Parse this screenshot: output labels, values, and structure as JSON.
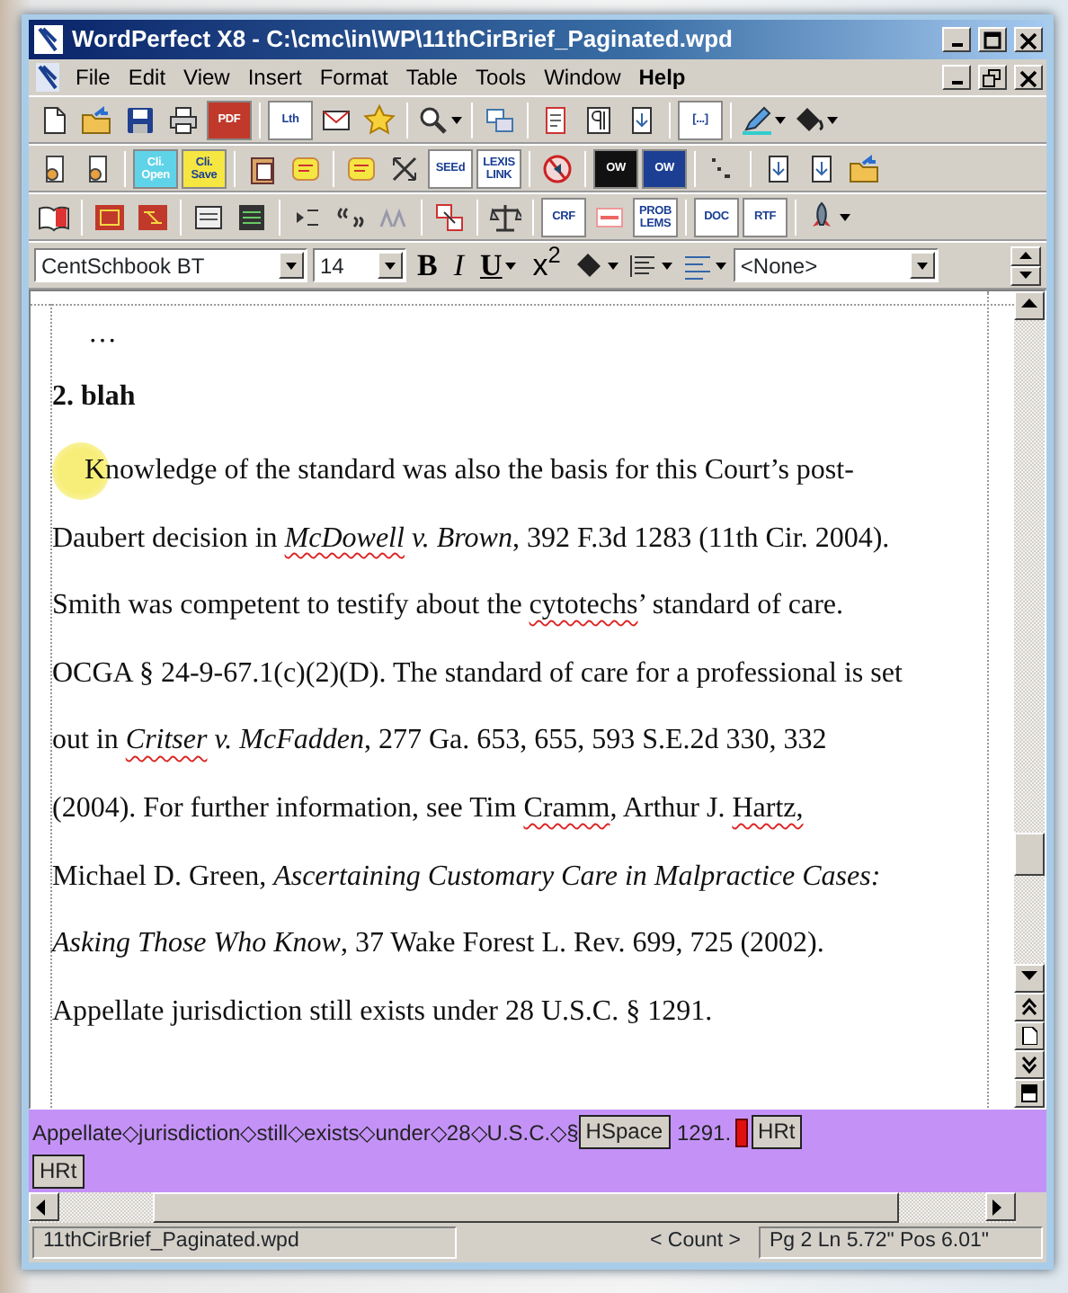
{
  "window": {
    "title": "WordPerfect X8 - C:\\cmc\\in\\WP\\11thCirBrief_Paginated.wpd"
  },
  "menu": [
    {
      "label": "File",
      "emphasized": false
    },
    {
      "label": "Edit",
      "emphasized": false
    },
    {
      "label": "View",
      "emphasized": false
    },
    {
      "label": "Insert",
      "emphasized": false
    },
    {
      "label": "Format",
      "emphasized": false
    },
    {
      "label": "Table",
      "emphasized": false
    },
    {
      "label": "Tools",
      "emphasized": false
    },
    {
      "label": "Window",
      "emphasized": false
    },
    {
      "label": "Help",
      "emphasized": true
    }
  ],
  "toolbars": [
    [
      {
        "kind": "icon"
      },
      {
        "kind": "icon"
      },
      {
        "kind": "icon"
      },
      {
        "kind": "icon"
      },
      {
        "kind": "label",
        "text": "PDF",
        "color": "#c0392b"
      },
      {
        "kind": "separator"
      },
      {
        "kind": "label",
        "text": "Lth",
        "color": "#ffffff"
      },
      {
        "kind": "icon"
      },
      {
        "kind": "icon"
      },
      {
        "kind": "separator"
      },
      {
        "kind": "icon",
        "dropdown": true
      },
      {
        "kind": "separator"
      },
      {
        "kind": "icon"
      },
      {
        "kind": "separator"
      },
      {
        "kind": "icon"
      },
      {
        "kind": "icon"
      },
      {
        "kind": "icon"
      },
      {
        "kind": "separator"
      },
      {
        "kind": "label",
        "text": "[...]",
        "color": "#ffffff"
      },
      {
        "kind": "separator"
      },
      {
        "kind": "icon",
        "dropdown": true
      },
      {
        "kind": "icon",
        "dropdown": true
      }
    ],
    [
      {
        "kind": "icon"
      },
      {
        "kind": "icon"
      },
      {
        "kind": "separator"
      },
      {
        "kind": "label",
        "text": "Cli. Open",
        "color": "#5fd3e8"
      },
      {
        "kind": "label",
        "text": "Cli. Save",
        "color": "#f5e642"
      },
      {
        "kind": "separator"
      },
      {
        "kind": "icon"
      },
      {
        "kind": "icon"
      },
      {
        "kind": "separator"
      },
      {
        "kind": "icon"
      },
      {
        "kind": "icon"
      },
      {
        "kind": "label",
        "text": "SEEd",
        "color": "#ffffff"
      },
      {
        "kind": "label",
        "text": "LEXIS LINK",
        "color": "#ffffff"
      },
      {
        "kind": "separator"
      },
      {
        "kind": "icon"
      },
      {
        "kind": "separator"
      },
      {
        "kind": "label",
        "text": "OW",
        "color": "#111111"
      },
      {
        "kind": "label",
        "text": "OW",
        "color": "#1c3f94"
      },
      {
        "kind": "separator"
      },
      {
        "kind": "icon"
      },
      {
        "kind": "separator"
      },
      {
        "kind": "icon"
      },
      {
        "kind": "icon"
      },
      {
        "kind": "icon"
      }
    ],
    [
      {
        "kind": "icon"
      },
      {
        "kind": "separator"
      },
      {
        "kind": "icon"
      },
      {
        "kind": "icon"
      },
      {
        "kind": "separator"
      },
      {
        "kind": "icon"
      },
      {
        "kind": "icon"
      },
      {
        "kind": "separator"
      },
      {
        "kind": "icon"
      },
      {
        "kind": "icon"
      },
      {
        "kind": "icon"
      },
      {
        "kind": "separator"
      },
      {
        "kind": "icon"
      },
      {
        "kind": "separator"
      },
      {
        "kind": "icon"
      },
      {
        "kind": "separator"
      },
      {
        "kind": "label",
        "text": "CRF",
        "color": "#ffffff"
      },
      {
        "kind": "icon"
      },
      {
        "kind": "label",
        "text": "PROB LEMS",
        "color": "#ffffff"
      },
      {
        "kind": "separator"
      },
      {
        "kind": "label",
        "text": "DOC",
        "color": "#ffffff"
      },
      {
        "kind": "label",
        "text": "RTF",
        "color": "#ffffff"
      },
      {
        "kind": "separator"
      },
      {
        "kind": "icon",
        "dropdown": true
      }
    ]
  ],
  "format_bar": {
    "font": "CentSchbook BT",
    "size": "14",
    "buttons": [
      {
        "label": "B",
        "dropdown": false
      },
      {
        "label": "I",
        "dropdown": false
      },
      {
        "label": "U",
        "dropdown": true
      },
      {
        "label": "x$^{2}$",
        "dropdown": false
      }
    ],
    "style": "<None>"
  },
  "document": {
    "lines": [
      {
        "kind": "ellipsis",
        "segments": [
          {
            "text": "…",
            "italic": false,
            "misspelled": false
          }
        ]
      },
      {
        "kind": "heading",
        "segments": [
          {
            "text": "2. blah",
            "italic": false,
            "misspelled": false
          }
        ]
      },
      {
        "kind": "first",
        "segments": [
          {
            "text": "Knowledge of the standard was also the basis for this Court’s post-",
            "italic": false,
            "misspelled": false
          }
        ]
      },
      {
        "kind": "body",
        "segments": [
          {
            "text": "Daubert decision in ",
            "italic": false,
            "misspelled": false
          },
          {
            "text": "McDowell",
            "italic": true,
            "misspelled": true
          },
          {
            "text": " v. Brown",
            "italic": true,
            "misspelled": false
          },
          {
            "text": ", 392 F.3d 1283 (11th Cir. 2004).",
            "italic": false,
            "misspelled": false
          }
        ]
      },
      {
        "kind": "body",
        "segments": [
          {
            "text": "Smith was competent to testify about the ",
            "italic": false,
            "misspelled": false
          },
          {
            "text": "cytotechs",
            "italic": false,
            "misspelled": true
          },
          {
            "text": "’ standard of care.",
            "italic": false,
            "misspelled": false
          }
        ]
      },
      {
        "kind": "body",
        "segments": [
          {
            "text": "OCGA § 24-9-67.1(c)(2)(D). The standard of care for a professional is set",
            "italic": false,
            "misspelled": false
          }
        ]
      },
      {
        "kind": "body",
        "segments": [
          {
            "text": "out in ",
            "italic": false,
            "misspelled": false
          },
          {
            "text": "Critser",
            "italic": true,
            "misspelled": true
          },
          {
            "text": " v. McFadden",
            "italic": true,
            "misspelled": false
          },
          {
            "text": ", 277 Ga. 653, 655, 593 S.E.2d 330, 332",
            "italic": false,
            "misspelled": false
          }
        ]
      },
      {
        "kind": "body",
        "segments": [
          {
            "text": "(2004). For further information, see Tim ",
            "italic": false,
            "misspelled": false
          },
          {
            "text": "Cramm",
            "italic": false,
            "misspelled": true
          },
          {
            "text": ", Arthur J. ",
            "italic": false,
            "misspelled": false
          },
          {
            "text": "Hartz,",
            "italic": false,
            "misspelled": true
          }
        ]
      },
      {
        "kind": "body",
        "segments": [
          {
            "text": "Michael D. Green, ",
            "italic": false,
            "misspelled": false
          },
          {
            "text": "Ascertaining Customary Care in Malpractice Cases:",
            "italic": true,
            "misspelled": false
          }
        ]
      },
      {
        "kind": "body",
        "segments": [
          {
            "text": "Asking Those Who Know",
            "italic": true,
            "misspelled": false
          },
          {
            "text": ", 37 Wake Forest L. Rev. 699, 725 (2002).",
            "italic": false,
            "misspelled": false
          }
        ]
      },
      {
        "kind": "body",
        "segments": [
          {
            "text": "Appellate jurisdiction still exists under 28 U.S.C. § 1291.",
            "italic": false,
            "misspelled": false
          }
        ]
      }
    ]
  },
  "reveal_codes": [
    [
      {
        "kind": "text",
        "text": "Appellate◇jurisdiction◇still◇exists◇under◇28◇U.S.C.◇§"
      },
      {
        "kind": "code",
        "text": "HSpace"
      },
      {
        "kind": "text",
        "text": "1291."
      },
      {
        "kind": "cursor"
      },
      {
        "kind": "code",
        "text": "HRt"
      }
    ],
    [
      {
        "kind": "code",
        "text": "HRt"
      }
    ]
  ],
  "status_bar": {
    "file": "11thCirBrief_Paginated.wpd",
    "count": "< Count >",
    "position": "Pg 2 Ln 5.72\" Pos 6.01\""
  }
}
